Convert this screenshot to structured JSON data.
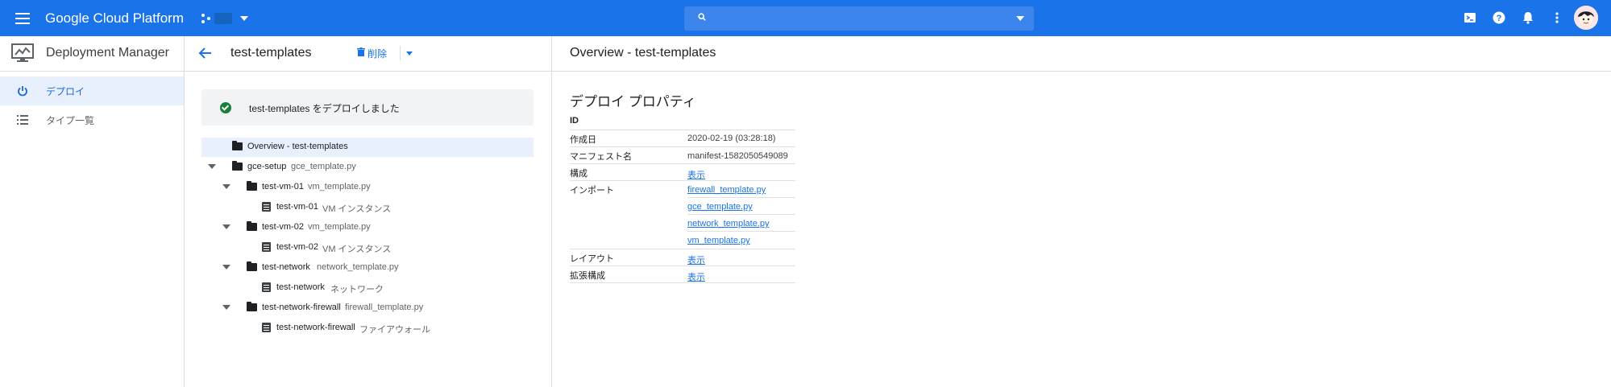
{
  "topbar": {
    "brand": "Google Cloud Platform",
    "search_placeholder": ""
  },
  "leftnav": {
    "product_title": "Deployment Manager",
    "items": [
      {
        "label": "デプロイ",
        "icon": "power-icon",
        "active": true
      },
      {
        "label": "タイプ一覧",
        "icon": "list-icon",
        "active": false
      }
    ]
  },
  "middle": {
    "title": "test-templates",
    "delete_label": "削除",
    "success_message": "test-templates をデプロイしました",
    "tree": [
      {
        "name": "Overview - test-templates",
        "sub": ""
      },
      {
        "name": "gce-setup",
        "sub": "gce_template.py"
      },
      {
        "name": "test-vm-01",
        "sub": "vm_template.py"
      },
      {
        "name": "test-vm-01",
        "sub": "VM インスタンス"
      },
      {
        "name": "test-vm-02",
        "sub": "vm_template.py"
      },
      {
        "name": "test-vm-02",
        "sub": "VM インスタンス"
      },
      {
        "name": "test-network",
        "sub": "network_template.py"
      },
      {
        "name": "test-network",
        "sub": "ネットワーク"
      },
      {
        "name": "test-network-firewall",
        "sub": "firewall_template.py"
      },
      {
        "name": "test-network-firewall",
        "sub": "ファイアウォール"
      }
    ]
  },
  "right": {
    "title": "Overview - test-templates",
    "section_title": "デプロイ プロパティ",
    "props": {
      "id_label": "ID",
      "created_label": "作成日",
      "created_value": "2020-02-19 (03:28:18)",
      "manifest_label": "マニフェスト名",
      "manifest_value": "manifest-1582050549089",
      "config_label": "構成",
      "config_link": "表示",
      "imports_label": "インポート",
      "imports": [
        "firewall_template.py",
        "gce_template.py",
        "network_template.py",
        "vm_template.py"
      ],
      "layout_label": "レイアウト",
      "layout_link": "表示",
      "expanded_label": "拡張構成",
      "expanded_link": "表示"
    }
  },
  "colors": {
    "topbar": "#1a73e8",
    "link": "#1a73e8",
    "success": "#188038",
    "nav_active_bg": "#e8f0fe"
  }
}
